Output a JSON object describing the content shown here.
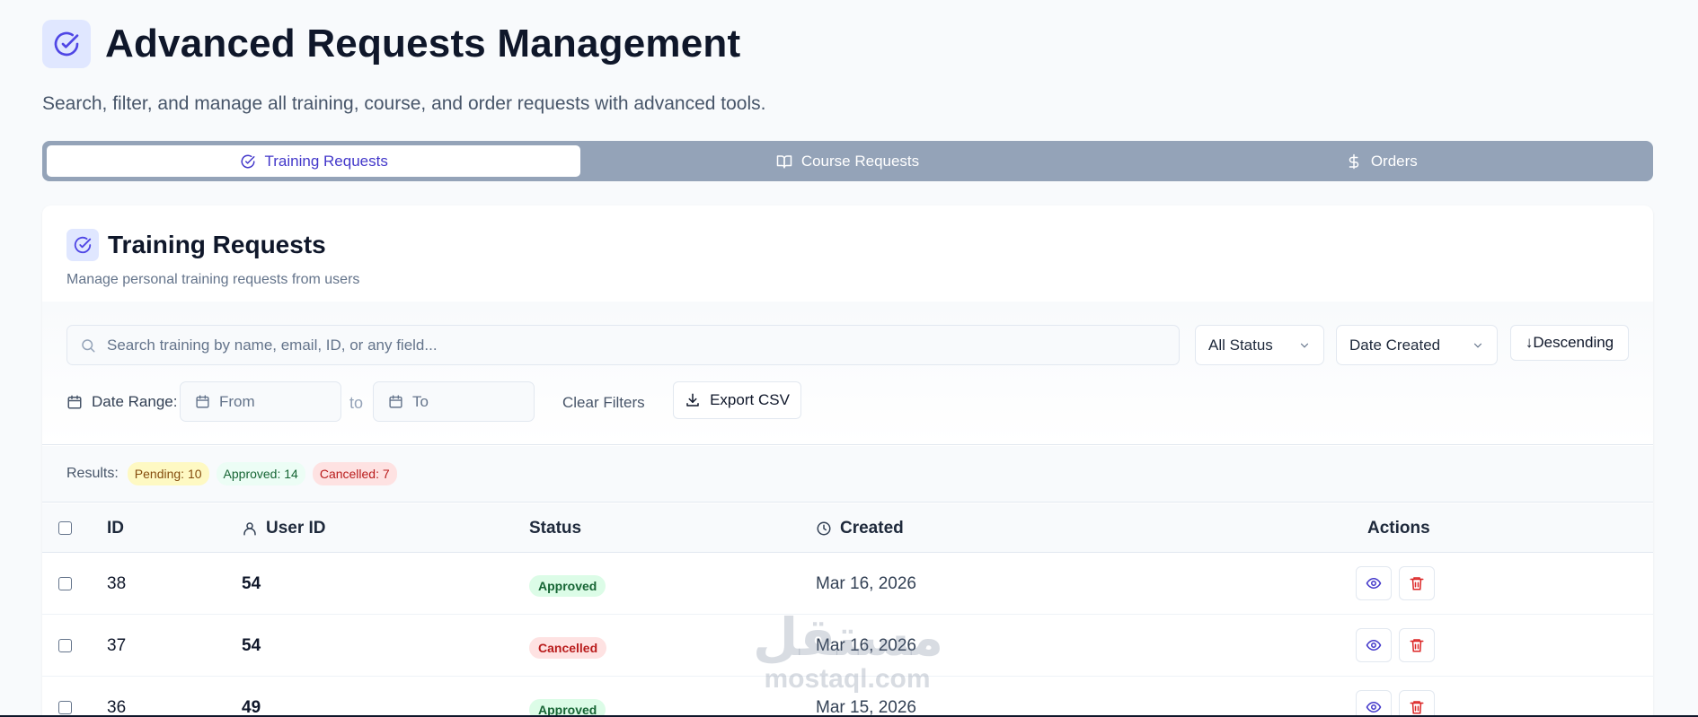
{
  "header": {
    "title": "Advanced Requests Management",
    "subtitle": "Search, filter, and manage all training, course, and order requests with advanced tools."
  },
  "tabs": [
    {
      "label": "Training Requests",
      "icon": "check-circle-icon",
      "active": true
    },
    {
      "label": "Course Requests",
      "icon": "book-open-icon",
      "active": false
    },
    {
      "label": "Orders",
      "icon": "dollar-icon",
      "active": false
    }
  ],
  "card": {
    "title": "Training Requests",
    "subtitle": "Manage personal training requests from users"
  },
  "filters": {
    "search_placeholder": "Search training by name, email, ID, or any field...",
    "status_value": "All Status",
    "sort_field_value": "Date Created",
    "sort_order_label": "↓Descending",
    "date_range_label": "Date Range:",
    "from_placeholder": "From",
    "to_text": "to",
    "to_placeholder": "To",
    "clear_label": "Clear Filters",
    "export_label": "Export CSV"
  },
  "results": {
    "label": "Results:",
    "pending": "Pending: 10",
    "approved": "Approved: 14",
    "cancelled": "Cancelled: 7"
  },
  "table": {
    "headers": {
      "id": "ID",
      "user_id": "User ID",
      "status": "Status",
      "created": "Created",
      "actions": "Actions"
    },
    "rows": [
      {
        "id": "38",
        "user_id": "54",
        "status": "Approved",
        "created": "Mar 16, 2026"
      },
      {
        "id": "37",
        "user_id": "54",
        "status": "Cancelled",
        "created": "Mar 16, 2026"
      },
      {
        "id": "36",
        "user_id": "49",
        "status": "Approved",
        "created": "Mar 15, 2026"
      }
    ]
  },
  "watermark": {
    "arabic": "مستقل",
    "latin": "mostaql.com"
  },
  "colors": {
    "accent": "#4338ca",
    "tab_bar": "#94a3b8",
    "approved_bg": "#dcfce7",
    "cancelled_bg": "#fee2e2",
    "delete_red": "#dc2626"
  }
}
